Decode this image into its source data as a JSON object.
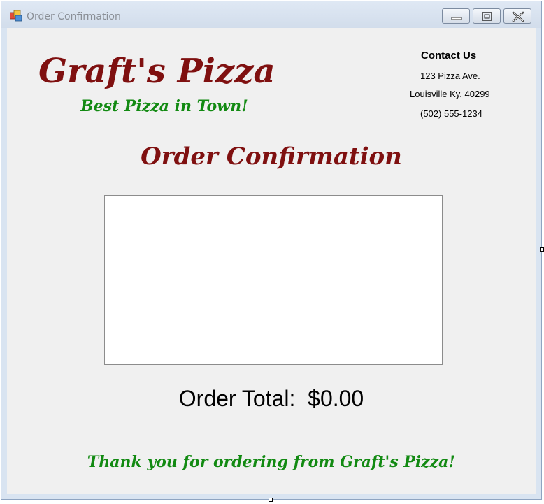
{
  "window": {
    "title": "Order Confirmation",
    "controls": [
      "minimize-icon",
      "maximize-icon",
      "close-icon"
    ]
  },
  "header": {
    "brand": "Graft's Pizza",
    "tagline": "Best Pizza in Town!"
  },
  "contact": {
    "heading": "Contact Us",
    "address": "123 Pizza Ave.",
    "city": "Louisville Ky. 40299",
    "phone": "(502) 555-1234"
  },
  "main": {
    "title": "Order Confirmation",
    "order_total_label": "Order Total:",
    "order_total_value": "$0.00",
    "thanks": "Thank you for ordering from Graft's Pizza!"
  },
  "colors": {
    "brand_red": "#7f1010",
    "brand_green": "#128a12"
  }
}
